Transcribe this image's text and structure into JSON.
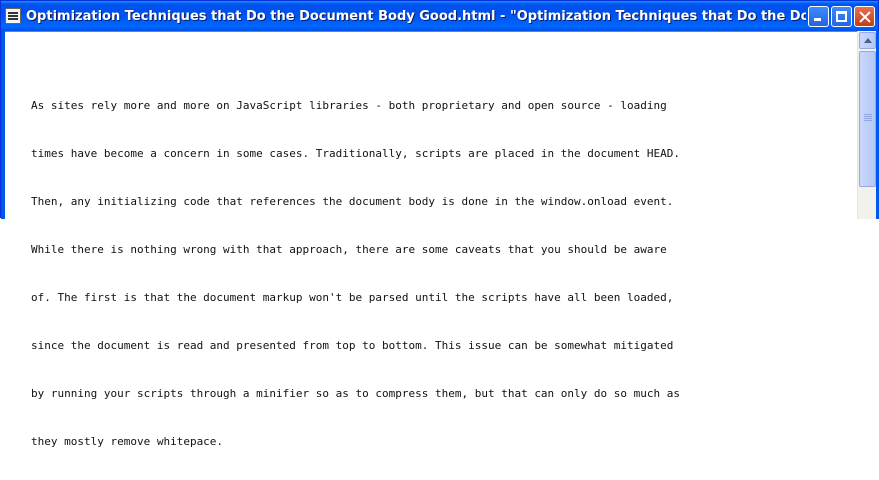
{
  "window": {
    "title": "Optimization Techniques that Do the Document Body Good.html - \"Optimization Techniques that Do the Document Body Go...",
    "icon": "document-icon"
  },
  "content": {
    "lines": [
      "As sites rely more and more on JavaScript libraries - both proprietary and open source - loading",
      "times have become a concern in some cases. Traditionally, scripts are placed in the document HEAD.",
      "Then, any initializing code that references the document body is done in the window.onload event.",
      "While there is nothing wrong with that approach, there are some caveats that you should be aware",
      "of. The first is that the document markup won't be parsed until the scripts have all been loaded,",
      "since the document is read and presented from top to bottom. This issue can be somewhat mitigated",
      "by running your scripts through a minifier so as to compress them, but that can only do so much as",
      "they mostly remove whitepace."
    ]
  },
  "colors": {
    "titlebar": "#0055ee",
    "close_button": "#c13d1a",
    "text": "#111111",
    "background": "#ffffff"
  }
}
